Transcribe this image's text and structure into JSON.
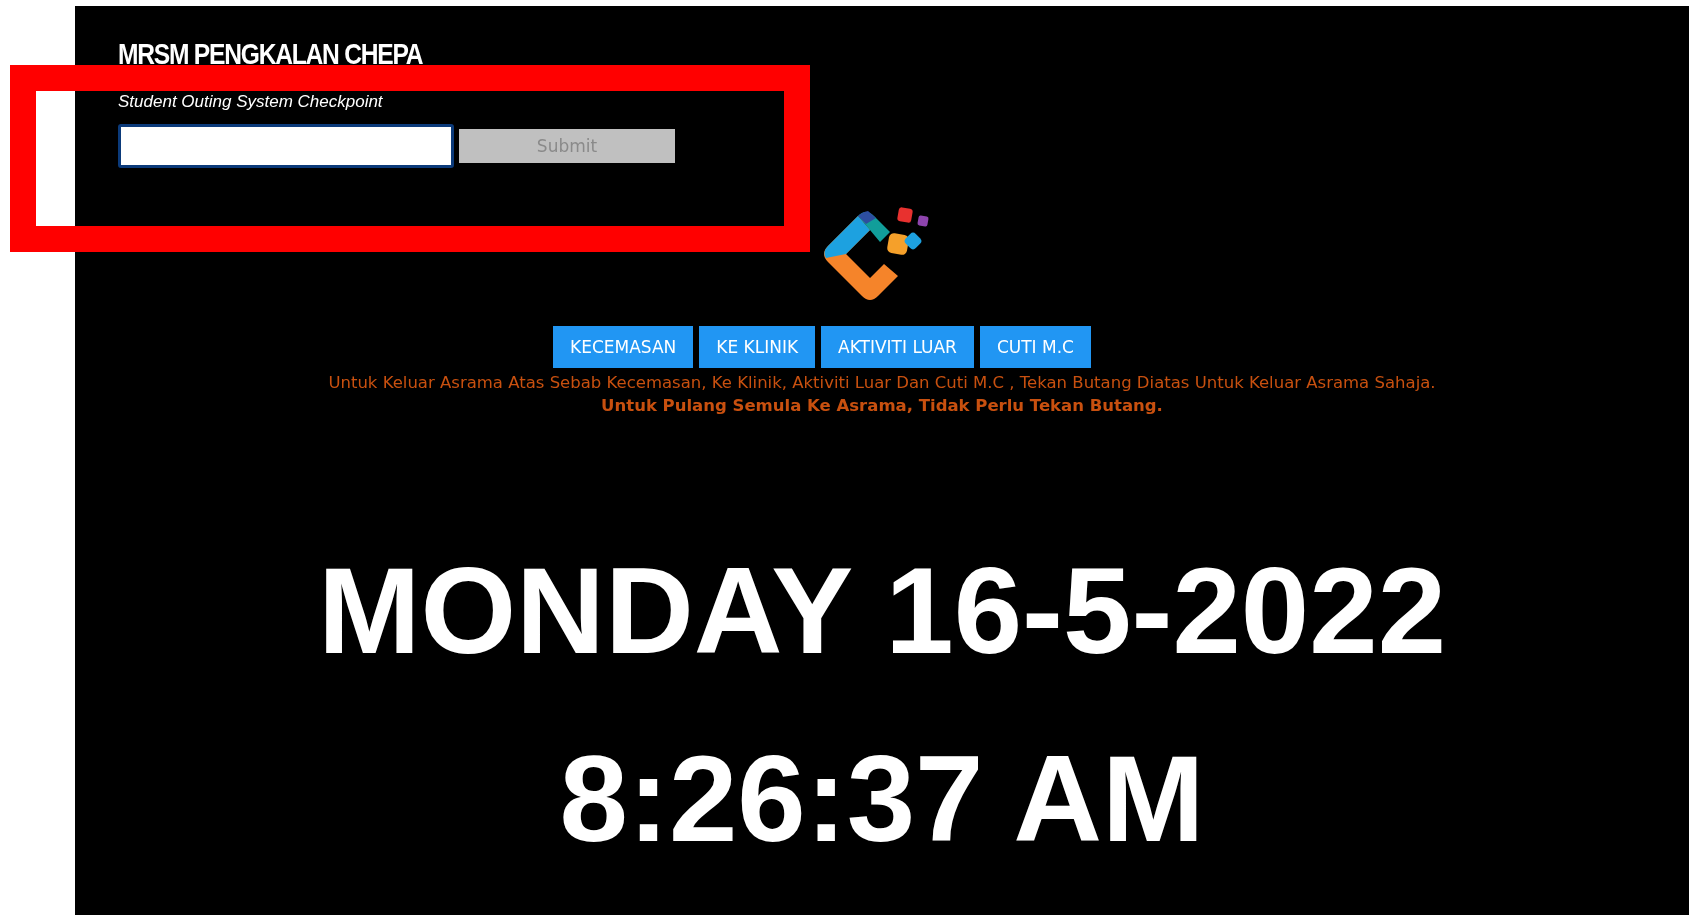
{
  "header": {
    "title": "MRSM PENGKALAN CHEPA",
    "label": "Student Outing System Checkpoint",
    "submit": {
      "label": "Submit",
      "disabled": true
    }
  },
  "buttons": [
    {
      "label": "KECEMASAN"
    },
    {
      "label": "KE KLINIK"
    },
    {
      "label": "AKTIVITI LUAR"
    },
    {
      "label": "CUTI M.C"
    }
  ],
  "notice": "Untuk Keluar Asrama Atas Sebab Kecemasan, Ke Klinik, Aktiviti Luar Dan Cuti M.C , Tekan Butang Diatas Untuk Keluar Asrama Sahaja.",
  "notice_bold": "Untuk Pulang Semula Ke Asrama, Tidak Perlu Tekan Butang.",
  "date": "MONDAY 16-5-2022",
  "time": "8:26:37 AM",
  "annotations": [
    {
      "kind": "frame"
    }
  ]
}
